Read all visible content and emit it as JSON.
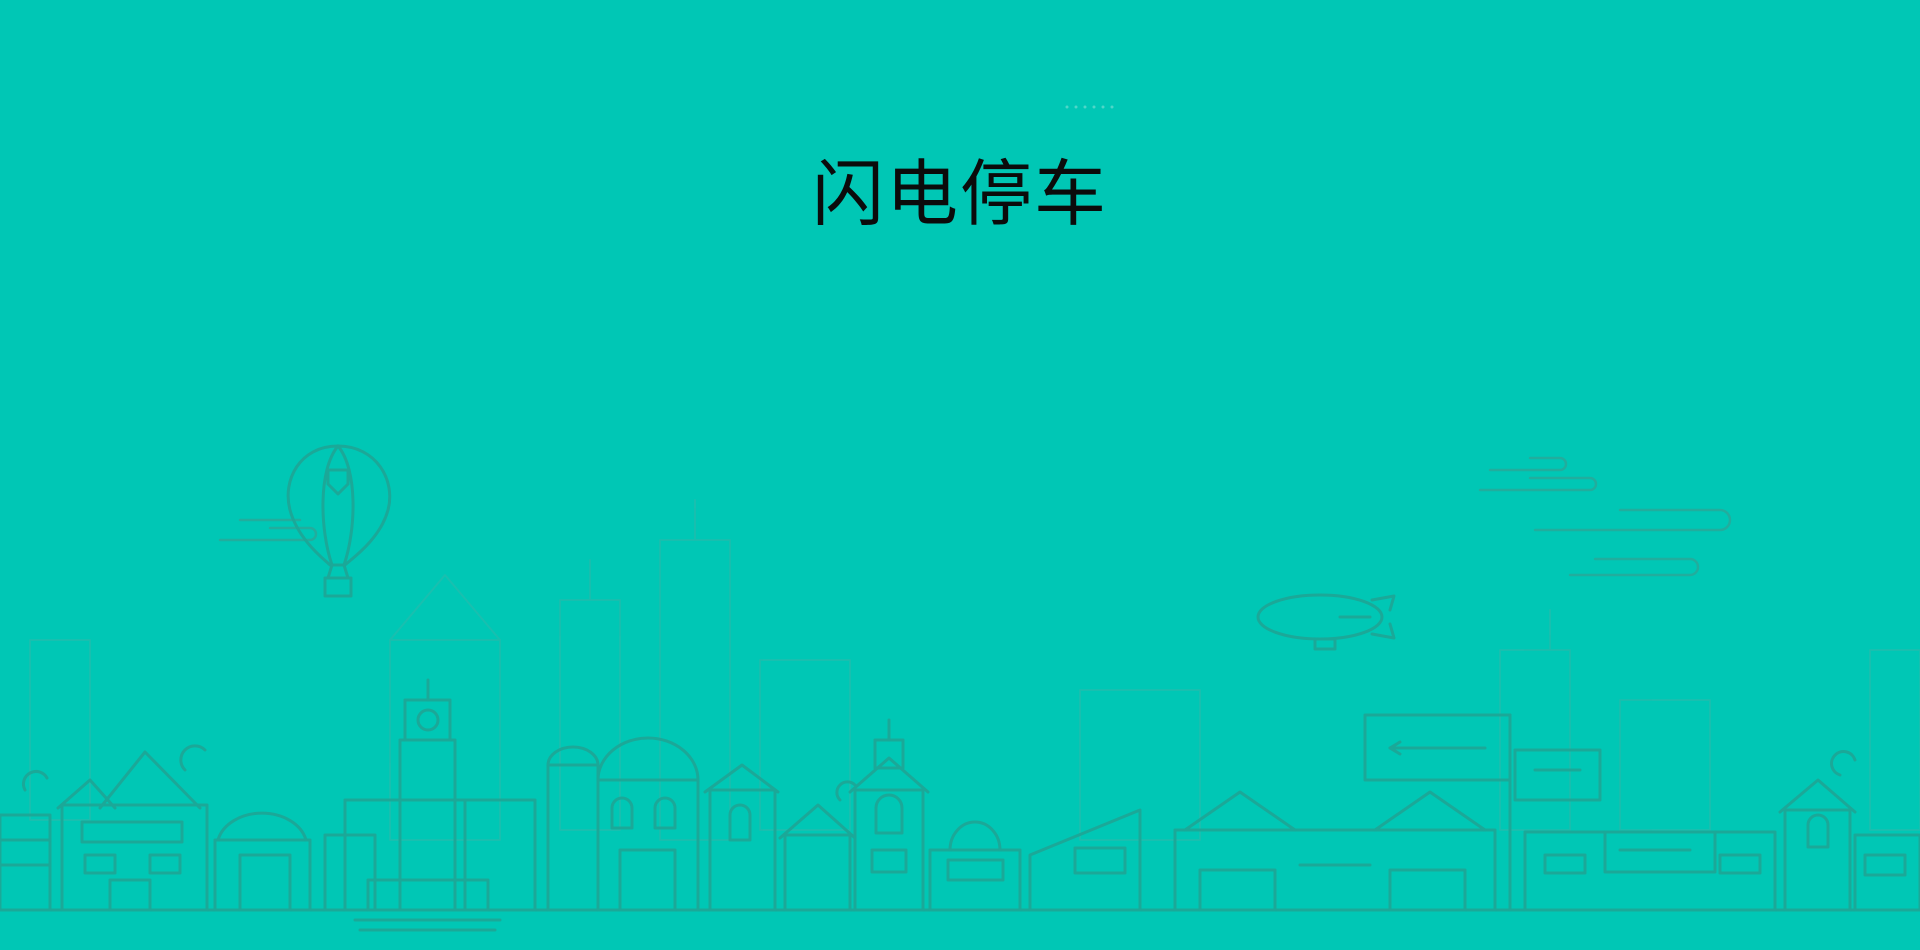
{
  "app": {
    "title": "闪电停车"
  },
  "theme": {
    "background": "#00c7b5",
    "line": "#18a898",
    "line_faint": "#2fb7a8",
    "text": "#0b0b0b"
  },
  "scene": {
    "icons": [
      "hot-air-balloon-icon",
      "airship-icon",
      "cloud-icon",
      "billboard-icon",
      "building-icon"
    ]
  }
}
